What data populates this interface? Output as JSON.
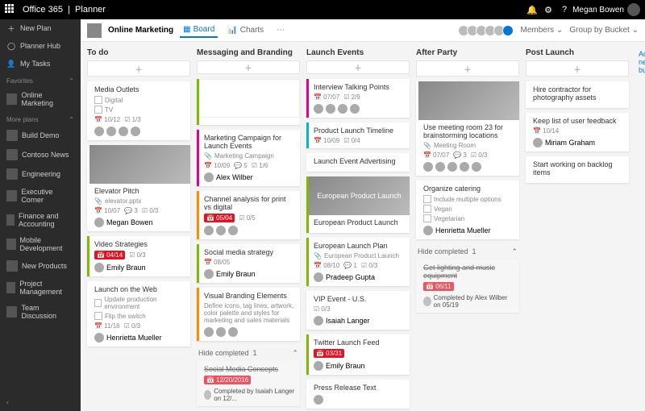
{
  "header": {
    "brand_suite": "Office 365",
    "brand_app": "Planner",
    "user_name": "Megan Bowen"
  },
  "sidebar": {
    "new_plan": "New Plan",
    "hub": "Planner Hub",
    "my_tasks": "My Tasks",
    "fav_hdr": "Favorites",
    "fav": [
      {
        "label": "Online Marketing"
      }
    ],
    "more_hdr": "More plans",
    "more": [
      {
        "label": "Build Demo"
      },
      {
        "label": "Contoso News"
      },
      {
        "label": "Engineering"
      },
      {
        "label": "Executive Corner"
      },
      {
        "label": "Finance and Accounting"
      },
      {
        "label": "Mobile Development"
      },
      {
        "label": "New Products"
      },
      {
        "label": "Project Management"
      },
      {
        "label": "Team Discussion"
      }
    ]
  },
  "planbar": {
    "title": "Online Marketing",
    "tab_board": "Board",
    "tab_charts": "Charts",
    "members": "Members",
    "group_by": "Group by Bucket"
  },
  "board": {
    "add_bucket": "Add new bu",
    "buckets": [
      {
        "name": "To do",
        "cards": [
          {
            "title": "Media Outlets",
            "checks": [
              "Digital",
              "TV"
            ],
            "meta_date": "10/12",
            "meta_sub": "1/3",
            "avatars": 4
          },
          {
            "title": "Elevator Pitch",
            "img": true,
            "sub": "elevator.pptx",
            "meta_date": "10/07",
            "meta_chat": "3",
            "meta_sub": "0/3",
            "assignee": "Megan Bowen"
          },
          {
            "title": "Video Strategies",
            "badge": "04/14",
            "meta_sub": "0/3",
            "assignee": "Emily Braun",
            "color": "green"
          },
          {
            "title": "Launch on the Web",
            "checks": [
              "Update production environment",
              "Flip the switch"
            ],
            "meta_date": "11/16",
            "meta_sub": "0/3",
            "assignee": "Henrietta Mueller"
          }
        ]
      },
      {
        "name": "Messaging and Branding",
        "cards": [
          {
            "title": "",
            "img": true,
            "doc": true,
            "color": "green"
          },
          {
            "title": "Marketing Campaign for Launch Events",
            "sub": "Marketing Campaign",
            "meta_date": "10/09",
            "meta_chat": "5",
            "meta_sub": "1/6",
            "assignee": "Alex Wilber",
            "color": "pink"
          },
          {
            "title": "Channel analysis for print vs digital",
            "badge": "05/04",
            "meta_sub": "0/5",
            "avatars": 3,
            "color": "orange"
          },
          {
            "title": "Social media strategy",
            "meta_date": "08/05",
            "assignee": "Emily Braun",
            "color": "green"
          },
          {
            "title": "Visual Branding Elements",
            "desc": "Define icons, tag lines, artwork, color palette and styles for marketing and sales materials",
            "avatars": 3,
            "color": "orange"
          }
        ],
        "hide_label": "Hide completed",
        "hide_count": "1",
        "completed": [
          {
            "title": "Social Media Concepts",
            "badge": "12/20/2016",
            "done_by": "Completed by Isaiah Langer on 12/..."
          }
        ]
      },
      {
        "name": "Launch Events",
        "cards": [
          {
            "title": "Interview Talking Points",
            "meta_date": "07/07",
            "meta_sub": "2/9",
            "avatars": 4,
            "color": "pink"
          },
          {
            "title": "Product Launch Timeline",
            "meta_date": "10/09",
            "meta_sub": "0/4",
            "color": "cyan"
          },
          {
            "title": "Launch Event Advertising"
          },
          {
            "title": "European Product Launch",
            "img": true,
            "overlay": "European Product Launch",
            "color": "green"
          },
          {
            "title": "European Launch Plan",
            "sub": "European Product Launch",
            "meta_date": "08/10",
            "meta_chat": "1",
            "meta_sub": "0/3",
            "assignee": "Pradeep Gupta",
            "color": "green"
          },
          {
            "title": "VIP Event - U.S.",
            "meta_sub": "0/3",
            "assignee": "Isaiah Langer"
          },
          {
            "title": "Twitter Launch Feed",
            "badge": "03/31",
            "assignee": "Emily Braun",
            "color": "green"
          },
          {
            "title": "Press Release Text",
            "avatars": 1
          }
        ]
      },
      {
        "name": "After Party",
        "cards": [
          {
            "title": "Use meeting room 23 for brainstorming locations",
            "img": true,
            "sub": "Meeting Room",
            "meta_date": "07/07",
            "meta_chat": "3",
            "meta_sub": "0/3",
            "avatars": 5
          },
          {
            "title": "Organize catering",
            "checks": [
              "Include multiple options",
              "Vegan",
              "Vegetarian"
            ],
            "assignee": "Henrietta Mueller"
          }
        ],
        "hide_label": "Hide completed",
        "hide_count": "1",
        "completed": [
          {
            "title": "Get lighting and music equipment",
            "badge": "06/11",
            "done_by": "Completed by Alex Wilber on 05/19"
          }
        ]
      },
      {
        "name": "Post Launch",
        "cards": [
          {
            "title": "Hire contractor for photography assets"
          },
          {
            "title": "Keep list of user feedback",
            "meta_date": "10/14",
            "assignee": "Miriam Graham"
          },
          {
            "title": "Start working on backlog items"
          }
        ]
      }
    ]
  }
}
